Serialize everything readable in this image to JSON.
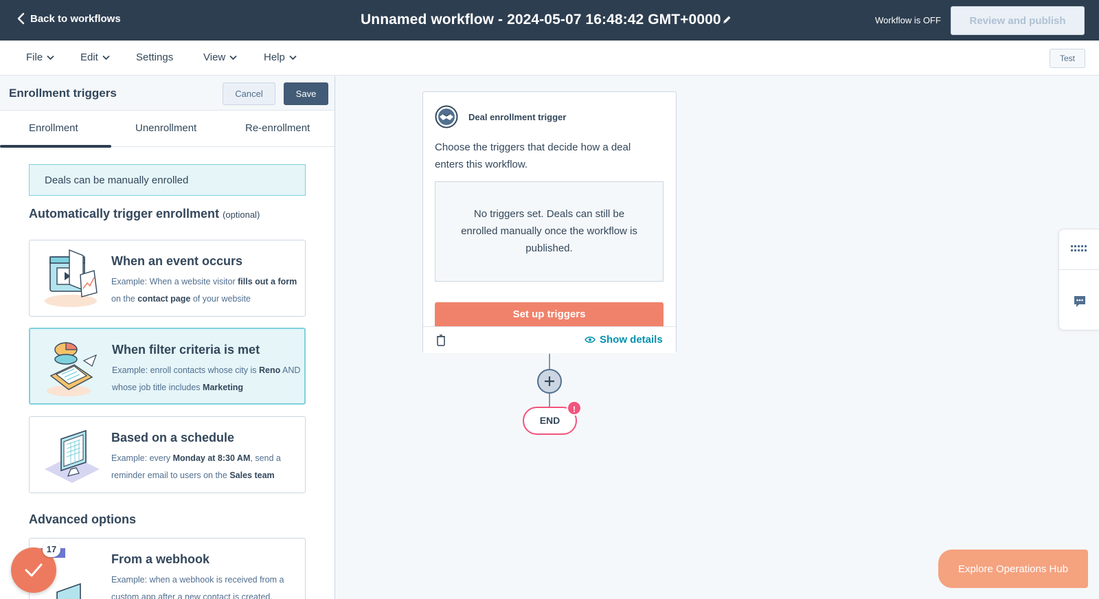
{
  "topbar": {
    "back_label": "Back to workflows",
    "title": "Unnamed workflow - 2024-05-07 16:48:42 GMT+0000",
    "status": "Workflow is OFF",
    "publish_label": "Review and publish"
  },
  "menu": {
    "file": "File",
    "edit": "Edit",
    "settings": "Settings",
    "view": "View",
    "help": "Help",
    "test": "Test"
  },
  "panel": {
    "title": "Enrollment triggers",
    "cancel": "Cancel",
    "save": "Save",
    "tabs": [
      "Enrollment",
      "Unenrollment",
      "Re-enrollment"
    ],
    "manual_note": "Deals can be manually enrolled",
    "auto_heading": "Automatically trigger enrollment",
    "auto_optional": "(optional)",
    "cards": [
      {
        "title": "When an event occurs",
        "desc": [
          "Example: When a website visitor ",
          "fills out a form",
          " on the ",
          "contact page",
          " of your website"
        ]
      },
      {
        "title": "When filter criteria is met",
        "desc": [
          "Example: enroll contacts whose city is ",
          "Reno",
          " AND whose job title includes ",
          "Marketing",
          ""
        ]
      },
      {
        "title": "Based on a schedule",
        "desc": [
          "Example: every ",
          "Monday at 8:30 AM",
          ", send a reminder email to users on the ",
          "Sales team",
          ""
        ]
      }
    ],
    "advanced_heading": "Advanced options",
    "webhook": {
      "title": "From a webhook",
      "desc": "Example: when a webhook is received from a custom app after a new contact is created,"
    },
    "badge_count": "17"
  },
  "canvas": {
    "trigger_title": "Deal enrollment trigger",
    "trigger_desc": "Choose the triggers that decide how a deal enters this workflow.",
    "no_triggers": "No triggers set. Deals can still be enrolled manually once the workflow is published.",
    "setup_label": "Set up triggers",
    "show_details": "Show details",
    "end_label": "END",
    "end_alert": "!"
  },
  "explore_label": "Explore Operations Hub",
  "colors": {
    "topbar": "#2d3e50",
    "accent_orange": "#f0826b",
    "teal_link": "#0091ae",
    "alert_pink": "#f2547d",
    "selected_bg": "#e5f5f8"
  }
}
